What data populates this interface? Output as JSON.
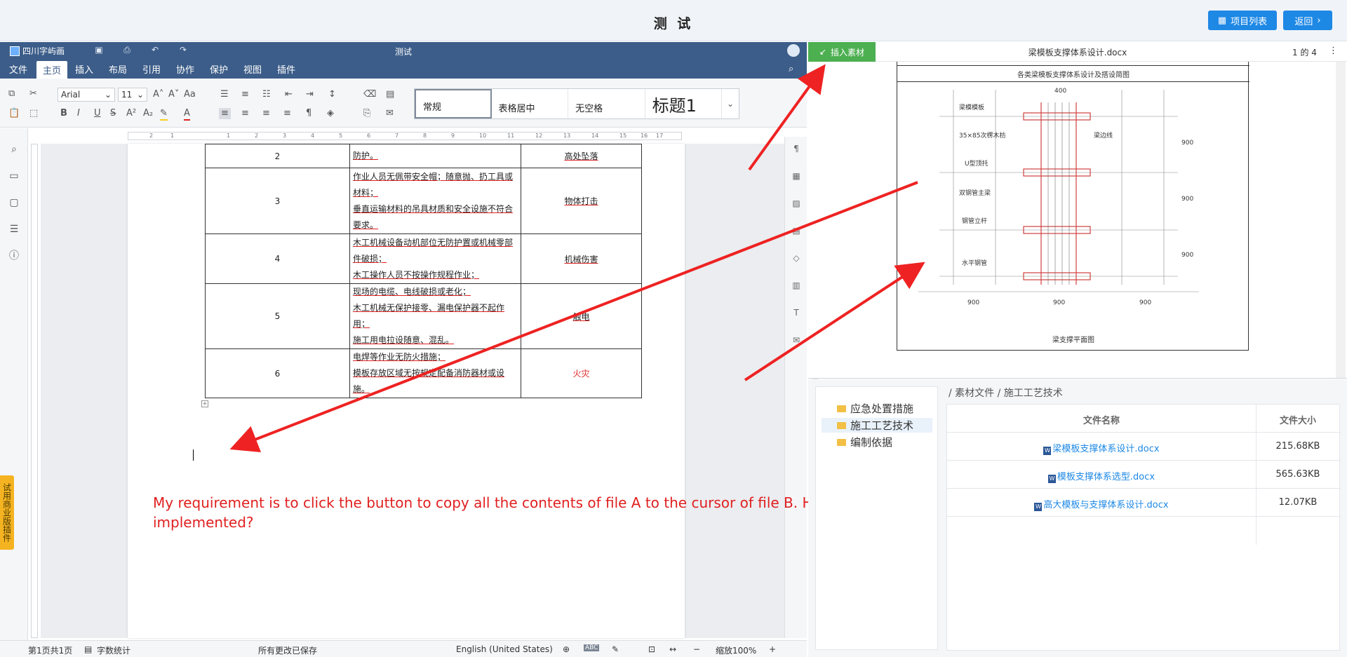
{
  "header": {
    "title": "测 试",
    "projects_label": "项目列表",
    "back_label": "返回"
  },
  "editor": {
    "brand": "四川字屿画",
    "doc_title": "测试",
    "menu": [
      "文件",
      "主页",
      "插入",
      "布局",
      "引用",
      "协作",
      "保护",
      "视图",
      "插件"
    ],
    "font": "Arial",
    "font_size": "11",
    "styles": [
      "常规",
      "表格居中",
      "无空格",
      "标题1"
    ],
    "yellow_tab": "试用商业版插件",
    "ruler_marks": [
      "2",
      "1",
      "1",
      "2",
      "3",
      "4",
      "5",
      "6",
      "7",
      "8",
      "9",
      "10",
      "11",
      "12",
      "13",
      "14",
      "15",
      "16",
      "17"
    ],
    "table_rows": [
      {
        "no": "2",
        "desc": [
          "防护。"
        ],
        "risk": "高处坠落"
      },
      {
        "no": "3",
        "desc": [
          "作业人员无佩带安全帽；随意抛、扔工具或材料；",
          "垂直运输材料的吊具材质和安全设施不符合要求。"
        ],
        "risk": "物体打击"
      },
      {
        "no": "4",
        "desc": [
          "木工机械设备动机部位无防护置或机械零部件破损；",
          "木工操作人员不按操作规程作业；"
        ],
        "risk": "机械伤害"
      },
      {
        "no": "5",
        "desc": [
          "现场的电缆、电线破损或老化；",
          "木工机械无保护接零、漏电保护器不起作用；",
          "施工用电拉设随意、混乱。"
        ],
        "risk": "触电"
      },
      {
        "no": "6",
        "desc": [
          "电焊等作业无防火措施；",
          "模板存放区域无按规定配备消防器材或设施。"
        ],
        "risk": "火灾"
      }
    ],
    "annotation": "My requirement is to click the button to copy all the contents of file A to the cursor of file B. How should it be implemented?",
    "status": {
      "page": "第1页共1页",
      "word_count": "字数统计",
      "saved": "所有更改已保存",
      "language": "English (United States)",
      "zoom": "缩放100%"
    }
  },
  "preview": {
    "insert_label": "插入素材",
    "filename": "梁模板支撑体系设计.docx",
    "pager": "1 的 4",
    "caption_top": "各类梁模板支撑体系设计及搭设简图",
    "caption_bottom": "梁支撑平面图",
    "dim_top": "400",
    "dims_bottom": [
      "900",
      "900",
      "900"
    ],
    "dims_side": [
      "900",
      "900",
      "900"
    ],
    "labels": [
      "梁模模板",
      "35×85次楞木枋",
      "U型顶托",
      "双钢管主梁",
      "钢管立杆",
      "水平钢管",
      "梁边线"
    ]
  },
  "files": {
    "tree": [
      "应急处置措施",
      "施工工艺技术",
      "编制依据"
    ],
    "active_tree": 1,
    "breadcrumb": [
      "素材文件",
      "施工工艺技术"
    ],
    "col_name": "文件名称",
    "col_size": "文件大小",
    "rows": [
      {
        "name": "梁模板支撑体系设计.docx",
        "size": "215.68KB"
      },
      {
        "name": "模板支撑体系选型.docx",
        "size": "565.63KB"
      },
      {
        "name": "高大模板与支撑体系设计.docx",
        "size": "12.07KB"
      }
    ]
  },
  "colors": {
    "accent": "#1e88e5",
    "editor_bar": "#3c5d89",
    "insert_green": "#4caf50",
    "annotation_red": "#e02020",
    "tab_yellow": "#f5b321"
  }
}
